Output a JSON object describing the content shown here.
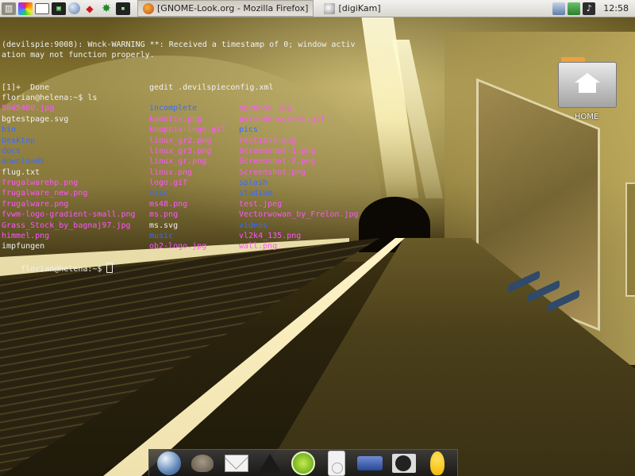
{
  "top_panel": {
    "taskbar": [
      {
        "label": "[GNOME-Look.org - Mozilla Firefox]",
        "active": true,
        "icon": "firefox-icon"
      },
      {
        "label": "[digiKam]",
        "active": false,
        "icon": "digikam-icon"
      }
    ],
    "clock": "12:58"
  },
  "terminal": {
    "warning_line_1": "(devilspie:9008): Wnck-WARNING **: Received a timestamp of 0; window activ",
    "warning_line_2": "ation may not function properly.",
    "job_done": "[1]+  Done",
    "job_command": "gedit .devilspieconfig.xml",
    "prompt_ls": "florian@helena:~$ ls",
    "rows": [
      [
        "5045480.jpg",
        "incomplete",
        "openbox.jpg"
      ],
      [
        "bgtestpage.svg",
        "kanotix.png",
        "periodensystem.gif"
      ],
      [
        "bin",
        "knoppix-logo.gif",
        "pics"
      ],
      [
        "Desktop",
        "linux_gr2.png",
        "rect1674.png"
      ],
      [
        "docs",
        "linux_gr3.png",
        "Screenshot-1.png"
      ],
      [
        "downloads",
        "linux_gr.png",
        "Screenshot-2.png"
      ],
      [
        "flug.txt",
        "linux.png",
        "Screenshot.png"
      ],
      [
        "frugalwarehp.png",
        "logo.gif",
        "splash"
      ],
      [
        "frugalware_new.png",
        "misc",
        "studium"
      ],
      [
        "frugalware.png",
        "ms48.png",
        "test.jpeg"
      ],
      [
        "fvwm-logo-gradient-small.png",
        "ms.png",
        "Vectorwowan_by_Frelon.jpg"
      ],
      [
        "Grass_Stock_by_bagnaj97.jpg",
        "ms.svg",
        "videos"
      ],
      [
        "himmel.png",
        "music",
        "vl2k4_135.png"
      ],
      [
        "impfungen",
        "ob2-logo.jpg",
        "wall.png"
      ]
    ],
    "row_types": [
      [
        "img",
        "dir",
        "img"
      ],
      [
        "plain",
        "img",
        "img"
      ],
      [
        "dir",
        "img",
        "dir"
      ],
      [
        "dir",
        "img",
        "img"
      ],
      [
        "dir",
        "img",
        "img"
      ],
      [
        "dir",
        "img",
        "img"
      ],
      [
        "plain",
        "img",
        "img"
      ],
      [
        "img",
        "img",
        "dir"
      ],
      [
        "img",
        "dir",
        "dir"
      ],
      [
        "img",
        "img",
        "img"
      ],
      [
        "img",
        "img",
        "img"
      ],
      [
        "img",
        "plain",
        "dir"
      ],
      [
        "img",
        "dir",
        "img"
      ],
      [
        "plain",
        "img",
        "img"
      ]
    ],
    "prompt_final": "florian@helena:~$ "
  },
  "desktop": {
    "home_icon_label": "HOME"
  },
  "colors": {
    "terminal_text": "#f1f1f1",
    "image_file": "#ff55ff",
    "directory": "#3b6bff"
  },
  "dock": {
    "items": [
      "globe-icon",
      "gimp-icon",
      "mail-icon",
      "inkscape-icon",
      "limewire-icon",
      "ipod-icon",
      "radio-icon",
      "turntable-icon",
      "aim-icon"
    ]
  }
}
